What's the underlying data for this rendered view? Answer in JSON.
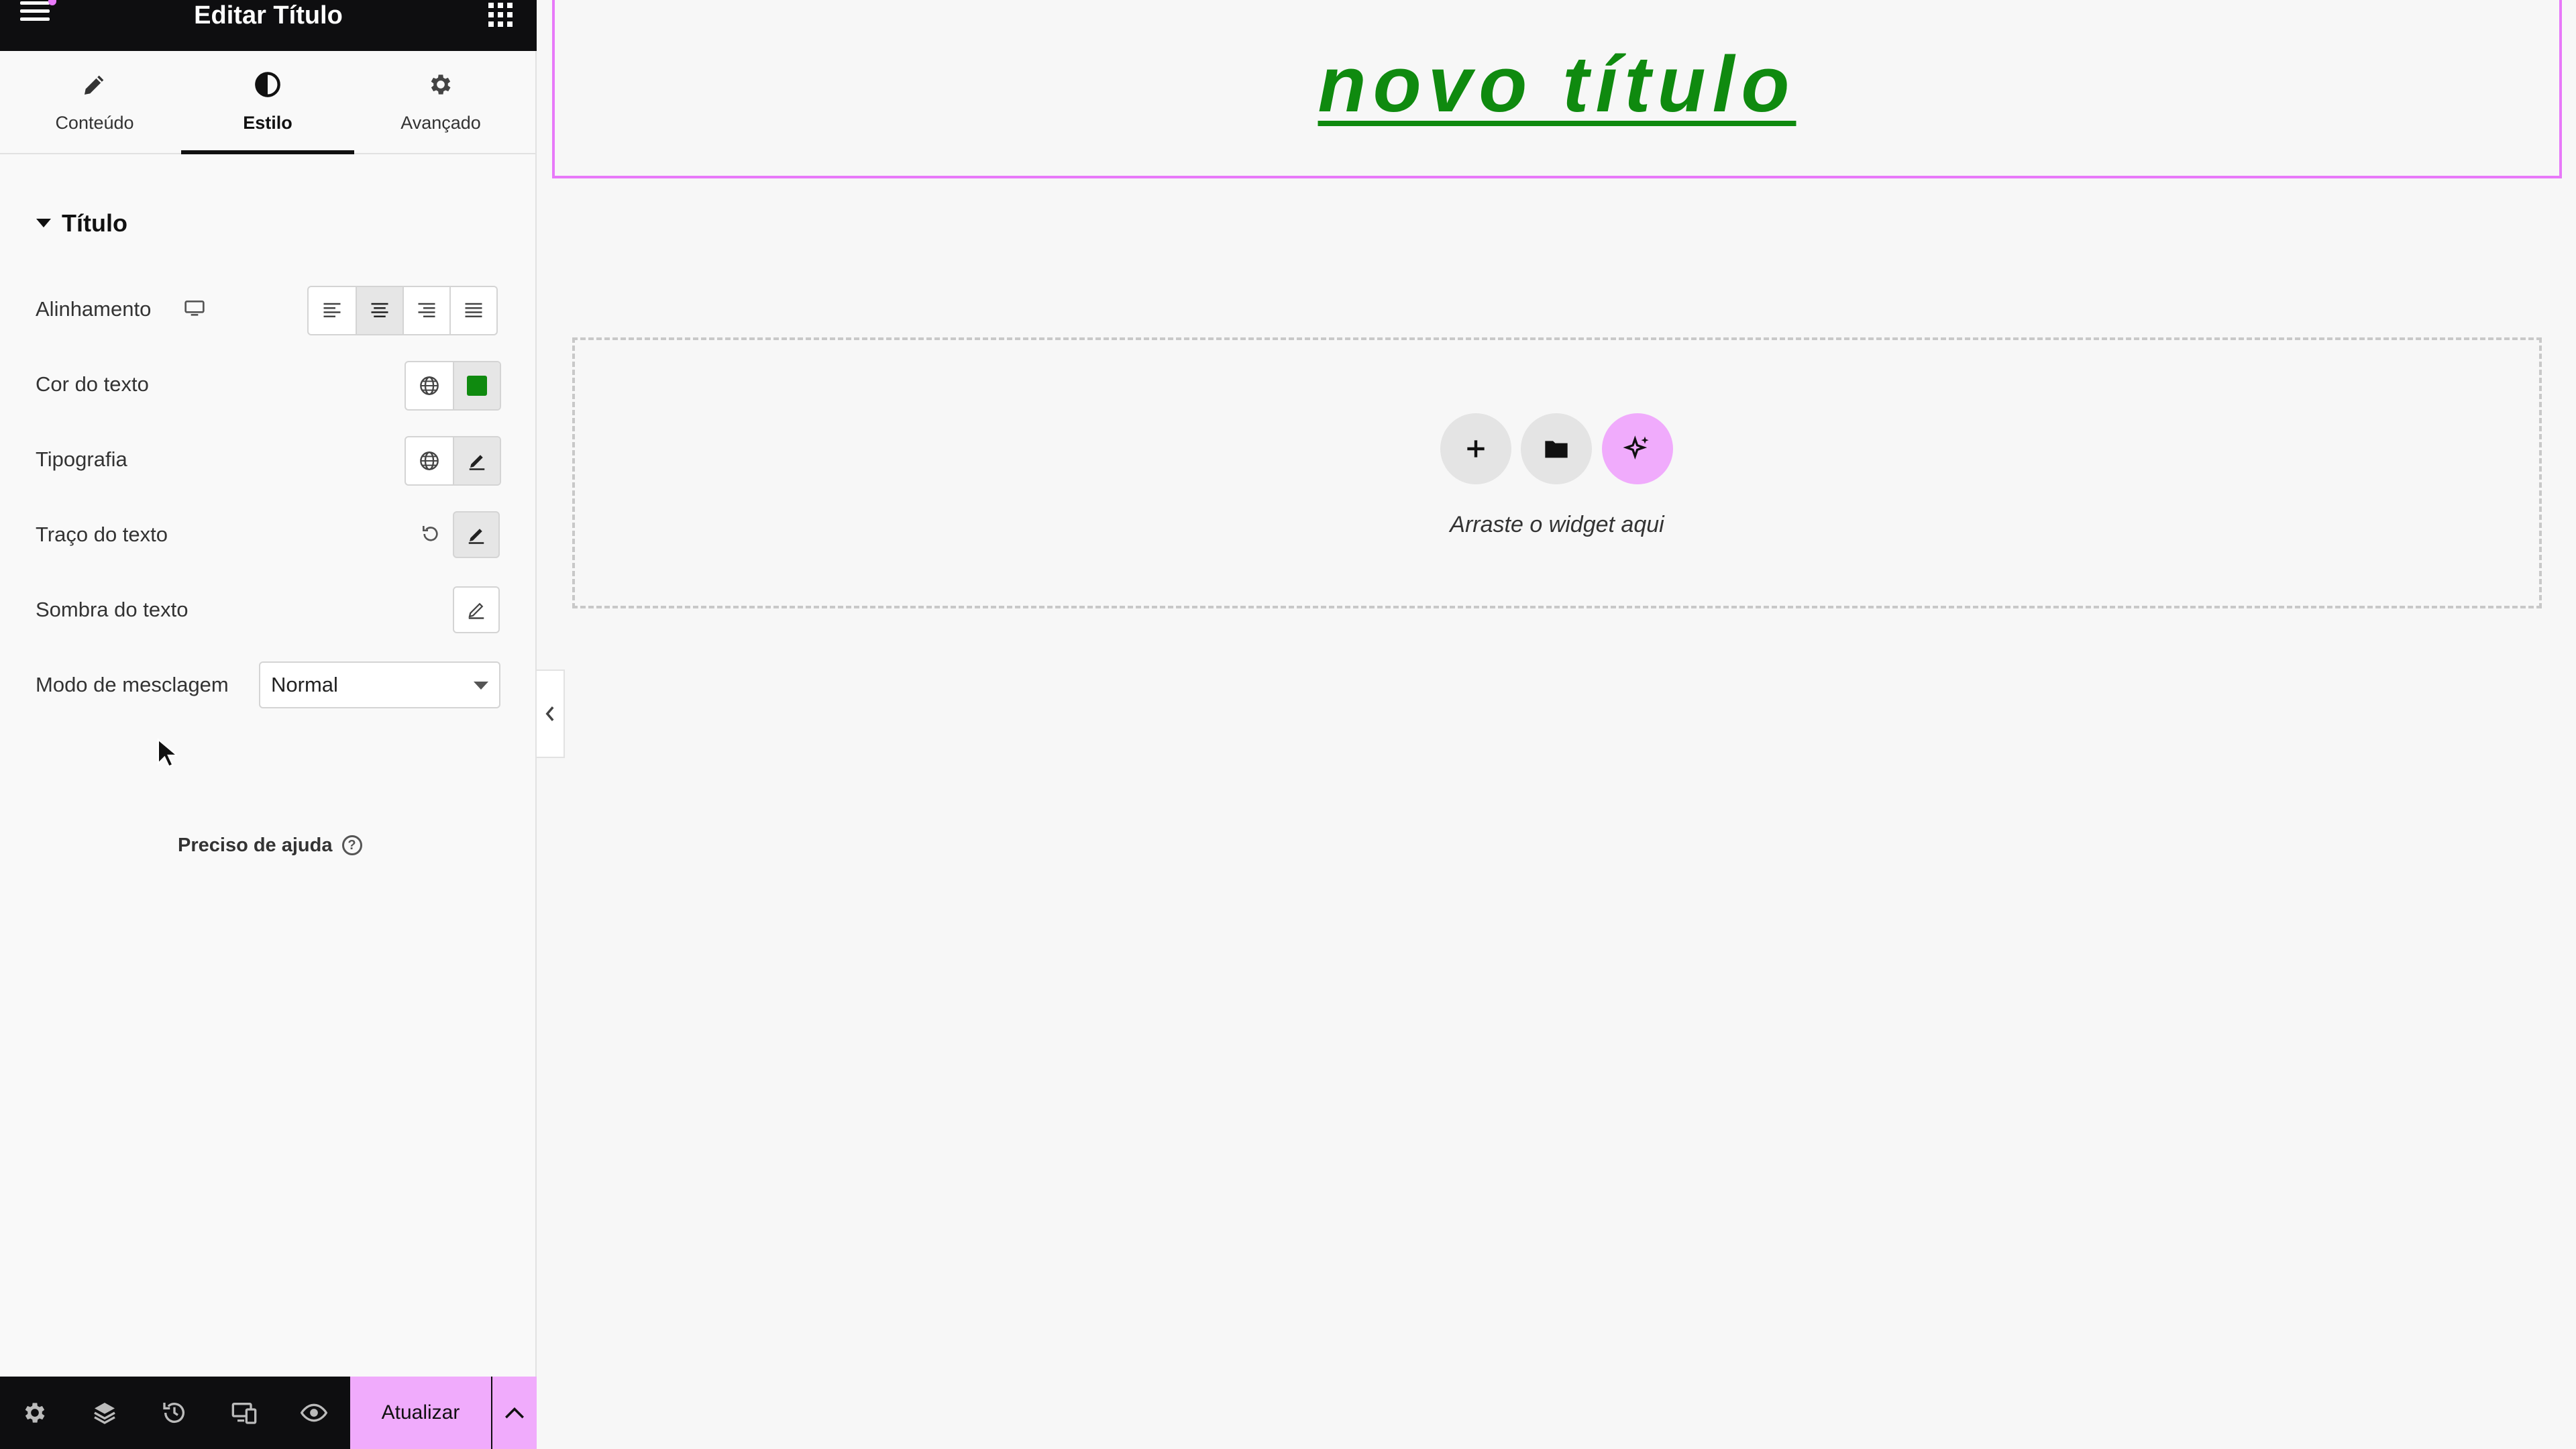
{
  "header": {
    "title": "Editar Título"
  },
  "tabs": [
    {
      "label": "Conteúdo",
      "icon": "pencil-icon"
    },
    {
      "label": "Estilo",
      "icon": "contrast-icon",
      "active": true
    },
    {
      "label": "Avançado",
      "icon": "gear-icon"
    }
  ],
  "section": {
    "title": "Título"
  },
  "controls": {
    "alignment_label": "Alinhamento",
    "alignment_selected": "center",
    "text_color_label": "Cor do texto",
    "text_color_value": "#0f8a0f",
    "typography_label": "Tipografia",
    "stroke_label": "Traço do texto",
    "shadow_label": "Sombra do texto",
    "blend_label": "Modo de mesclagem",
    "blend_value": "Normal"
  },
  "help": {
    "label": "Preciso de ajuda",
    "icon": "?"
  },
  "footer": {
    "update_label": "Atualizar"
  },
  "canvas": {
    "heading": "novo título",
    "drop_text": "Arraste o widget aqui"
  },
  "colors": {
    "accent": "#f0abfc",
    "selection_border": "#e879f9",
    "heading_color": "#0f8a0f",
    "dark": "#0e0e10"
  }
}
